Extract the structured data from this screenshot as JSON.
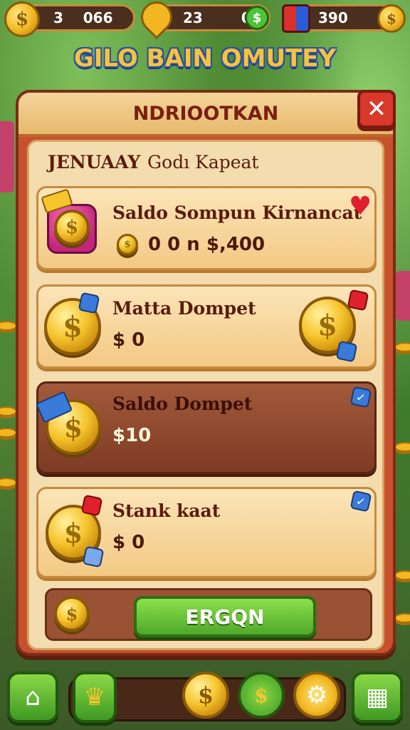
{
  "top_bar": {
    "coins_value": "3    066",
    "location_value": "23",
    "cash_value": "0",
    "cash_icon": "$",
    "gems_value": "390",
    "gold_icon": "$"
  },
  "game_title": "GILO BAIN OMUTEY",
  "panel": {
    "title": "NDRIOOTKAN",
    "close_label": "✕",
    "subtitle_part1": "JENUAAY",
    "subtitle_part2": "Godı Kapeat"
  },
  "cards": [
    {
      "title": "Saldo Sompun Kirnancat",
      "value": "0 0 n $,400",
      "style": "light"
    },
    {
      "title": "Matta Dompet",
      "value": "$ 0",
      "style": "light"
    },
    {
      "title": "Saldo Dompet",
      "value": "$10",
      "style": "dark"
    },
    {
      "title": "Stank kaat",
      "value": "$ 0",
      "style": "light"
    }
  ],
  "action_button": {
    "label": "ERGQN"
  },
  "coin_symbol": "$",
  "icons": {
    "home": "home-icon",
    "trophy": "trophy-icon",
    "coin": "coin-icon",
    "settings": "gear-icon",
    "map": "map-icon",
    "heart": "heart-icon",
    "close": "close-icon"
  },
  "colors": {
    "panel": "#c8502c",
    "panel_body": "#f3dcae",
    "card_light": "#f3c984",
    "card_dark": "#7e3b24",
    "button_green": "#4fa82a",
    "coin_gold": "#f6c42c",
    "title_text": "#7a1f10"
  }
}
